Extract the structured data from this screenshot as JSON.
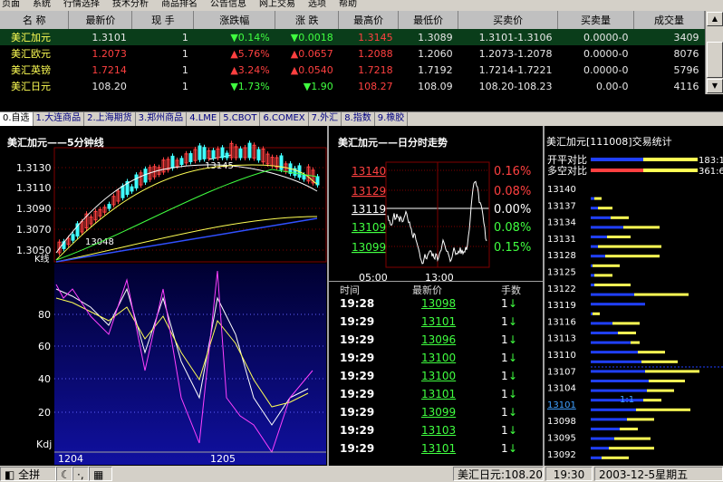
{
  "menu": [
    "页面",
    "系统",
    "行情选择",
    "技术分析",
    "商品排名",
    "公告信息",
    "网上交易",
    "选项",
    "帮助"
  ],
  "quote_table": {
    "headers": [
      "名 称",
      "最新价",
      "现 手",
      "涨跌幅",
      "涨 跌",
      "最高价",
      "最低价",
      "买卖价",
      "买卖量",
      "成交量"
    ],
    "rows": [
      {
        "name": "美汇加元",
        "last": "1.3101",
        "hand": "1",
        "pct_arrow": "▼",
        "pct": "0.14%",
        "chg_arrow": "▼",
        "chg": "0.0018",
        "high": "1.3145",
        "low": "1.3089",
        "bidask": "1.3101-1.3106",
        "qty": "0.0000-0",
        "vol": "3409",
        "dir": "dn"
      },
      {
        "name": "美汇欧元",
        "last": "1.2073",
        "hand": "1",
        "pct_arrow": "▲",
        "pct": "5.76%",
        "chg_arrow": "▲",
        "chg": "0.0657",
        "high": "1.2088",
        "low": "1.2060",
        "bidask": "1.2073-1.2078",
        "qty": "0.0000-0",
        "vol": "8076",
        "dir": "up"
      },
      {
        "name": "美汇英镑",
        "last": "1.7214",
        "hand": "1",
        "pct_arrow": "▲",
        "pct": "3.24%",
        "chg_arrow": "▲",
        "chg": "0.0540",
        "high": "1.7218",
        "low": "1.7192",
        "bidask": "1.7214-1.7221",
        "qty": "0.0000-0",
        "vol": "5796",
        "dir": "up"
      },
      {
        "name": "美汇日元",
        "last": "108.20",
        "hand": "1",
        "pct_arrow": "▼",
        "pct": "1.73%",
        "chg_arrow": "▼",
        "chg": "1.90",
        "high": "108.27",
        "low": "108.09",
        "bidask": "108.20-108.23",
        "qty": "0.00-0",
        "vol": "4116",
        "dir": "dn"
      }
    ]
  },
  "tabs": [
    "0.自选",
    "1.大连商品",
    "2.上海期货",
    "3.郑州商品",
    "4.LME",
    "5.CBOT",
    "6.COMEX",
    "7.外汇",
    "8.指数",
    "9.橡胶"
  ],
  "kline": {
    "title": "美汇加元——5分钟线",
    "price_labels": [
      "1.3130",
      "1.3110",
      "1.3090",
      "1.3070",
      "1.3050"
    ],
    "k_label": "K线",
    "high_mark": "13145",
    "low_mark": "13048",
    "kdj_label": "Kdj",
    "kdj_levels": [
      "80",
      "60",
      "40",
      "20"
    ],
    "dates": [
      "1204",
      "1205"
    ]
  },
  "intraday": {
    "title": "美汇加元——日分时走势",
    "prices": [
      "13140",
      "13129",
      "13119",
      "13109",
      "13099"
    ],
    "pcts": [
      "0.16%",
      "0.08%",
      "0.00%",
      "0.08%",
      "0.15%"
    ],
    "times": [
      "05:00",
      "13:00"
    ]
  },
  "ticks": {
    "headers": [
      "时间",
      "最新价",
      "手数"
    ],
    "rows": [
      {
        "time": "19:28",
        "price": "13098",
        "qty": "1",
        "arrow": "↓"
      },
      {
        "time": "19:29",
        "price": "13101",
        "qty": "1",
        "arrow": "↓"
      },
      {
        "time": "19:29",
        "price": "13096",
        "qty": "1",
        "arrow": "↓"
      },
      {
        "time": "19:29",
        "price": "13100",
        "qty": "1",
        "arrow": "↓"
      },
      {
        "time": "19:29",
        "price": "13100",
        "qty": "1",
        "arrow": "↓"
      },
      {
        "time": "19:29",
        "price": "13101",
        "qty": "1",
        "arrow": "↓"
      },
      {
        "time": "19:29",
        "price": "13099",
        "qty": "1",
        "arrow": "↓"
      },
      {
        "time": "19:29",
        "price": "13103",
        "qty": "1",
        "arrow": "↓"
      },
      {
        "time": "19:29",
        "price": "13101",
        "qty": "1",
        "arrow": "↓"
      }
    ]
  },
  "stats": {
    "title": "美汇加元[111008]交易统计",
    "kaiping_label": "开平对比",
    "kaiping_value": "183:1",
    "duokong_label": "多空对比",
    "duokong_value": "361:6",
    "levels": [
      "13140",
      "13137",
      "13134",
      "13131",
      "13128",
      "13125",
      "13122",
      "13119",
      "13116",
      "13113",
      "13110",
      "13107",
      "13104",
      "13101",
      "13098",
      "13095",
      "13092"
    ],
    "current_ratio": "1:1"
  },
  "bottom": {
    "full_label": "全拼",
    "ticker": "美汇日元:108.20",
    "time": "19:30",
    "date": "2003-12-5星期五"
  },
  "colors": {
    "up": "#ff4040",
    "down": "#40ff40",
    "accent": "#ffff54"
  }
}
